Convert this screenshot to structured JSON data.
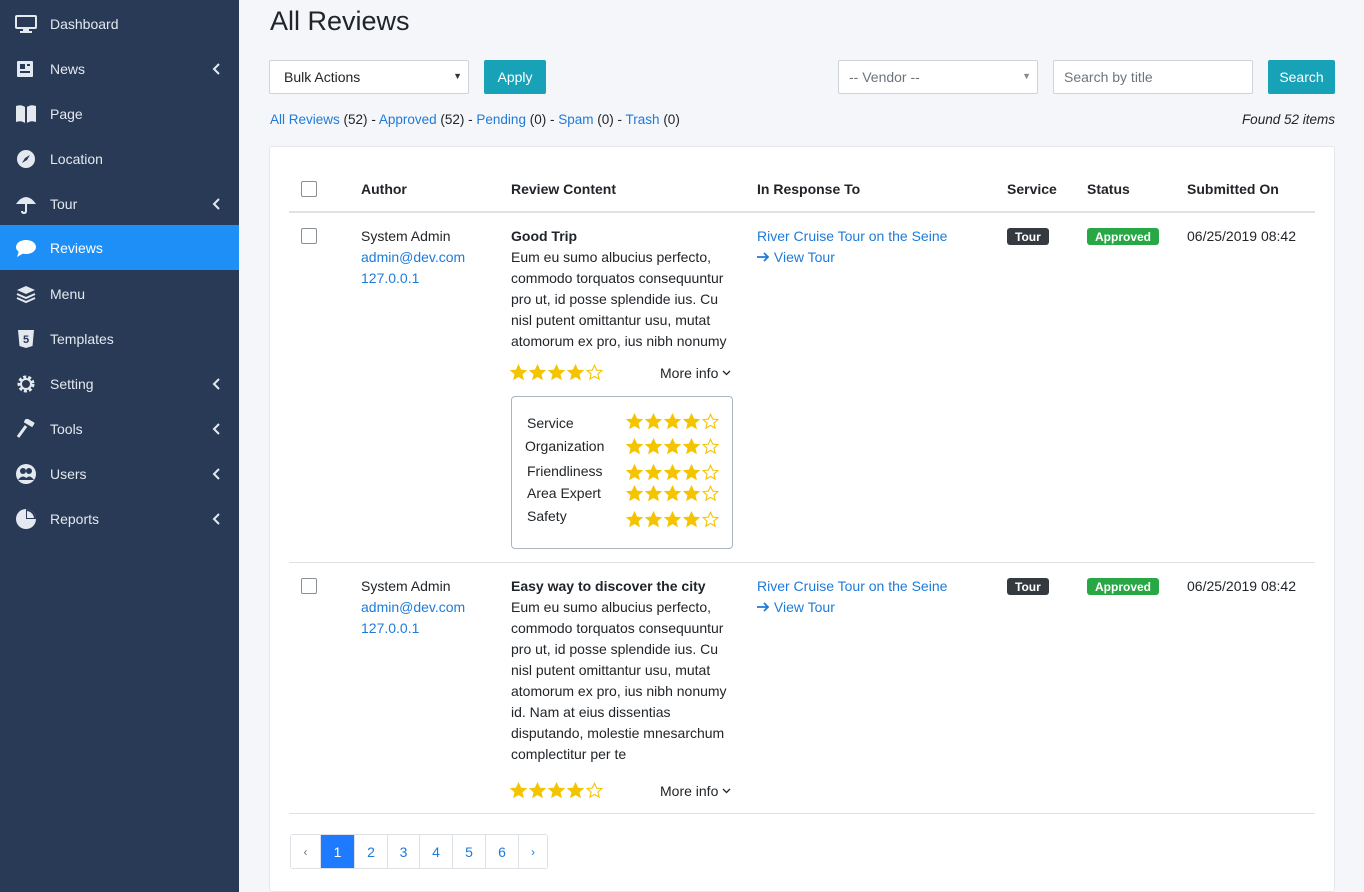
{
  "sidebar": {
    "items": [
      {
        "label": "Dashboard",
        "icon": "monitor-icon",
        "has_submenu": false,
        "active": false
      },
      {
        "label": "News",
        "icon": "newspaper-icon",
        "has_submenu": true,
        "active": false
      },
      {
        "label": "Page",
        "icon": "book-icon",
        "has_submenu": false,
        "active": false
      },
      {
        "label": "Location",
        "icon": "compass-icon",
        "has_submenu": false,
        "active": false
      },
      {
        "label": "Tour",
        "icon": "umbrella-icon",
        "has_submenu": true,
        "active": false
      },
      {
        "label": "Reviews",
        "icon": "comment-icon",
        "has_submenu": false,
        "active": true
      },
      {
        "label": "Menu",
        "icon": "layers-icon",
        "has_submenu": false,
        "active": false
      },
      {
        "label": "Templates",
        "icon": "html5-icon",
        "has_submenu": false,
        "active": false
      },
      {
        "label": "Setting",
        "icon": "gear-icon",
        "has_submenu": true,
        "active": false
      },
      {
        "label": "Tools",
        "icon": "hammer-icon",
        "has_submenu": true,
        "active": false
      },
      {
        "label": "Users",
        "icon": "users-icon",
        "has_submenu": true,
        "active": false
      },
      {
        "label": "Reports",
        "icon": "pie-chart-icon",
        "has_submenu": true,
        "active": false
      }
    ]
  },
  "page": {
    "title": "All Reviews",
    "bulk_actions": "Bulk Actions",
    "apply": "Apply",
    "vendor_placeholder": "-- Vendor --",
    "search_placeholder": "Search by title",
    "search": "Search",
    "found": "Found 52 items"
  },
  "filters": [
    {
      "label": "All Reviews",
      "count": "(52)"
    },
    {
      "label": "Approved",
      "count": "(52)"
    },
    {
      "label": "Pending",
      "count": "(0)"
    },
    {
      "label": "Spam",
      "count": "(0)"
    },
    {
      "label": "Trash",
      "count": "(0)"
    }
  ],
  "table": {
    "headers": {
      "author": "Author",
      "content": "Review Content",
      "response": "In Response To",
      "service": "Service",
      "status": "Status",
      "submitted": "Submitted On"
    },
    "rows": [
      {
        "author_name": "System Admin",
        "author_email": "admin@dev.com",
        "author_ip": "127.0.0.1",
        "title": "Good Trip",
        "body": "Eum eu sumo albucius perfecto, commodo torquatos consequuntur pro ut, id posse splendide ius. Cu nisl putent omittantur usu, mutat atomorum ex pro, ius nibh nonumy",
        "rating": 4,
        "more_info": "More info",
        "response_link": "River Cruise Tour on the Seine",
        "view_link": "View Tour",
        "service": "Tour",
        "status": "Approved",
        "submitted": "06/25/2019 08:42"
      },
      {
        "author_name": "System Admin",
        "author_email": "admin@dev.com",
        "author_ip": "127.0.0.1",
        "title": "Easy way to discover the city",
        "body": "Eum eu sumo albucius perfecto, commodo torquatos consequuntur pro ut, id posse splendide ius. Cu nisl putent omittantur usu, mutat atomorum ex pro, ius nibh nonumy id. Nam at eius dissentias disputando, molestie mnesarchum complectitur per te",
        "rating": 4,
        "more_info": "More info",
        "response_link": "River Cruise Tour on the Seine",
        "view_link": "View Tour",
        "service": "Tour",
        "status": "Approved",
        "submitted": "06/25/2019 08:42"
      }
    ],
    "detail_ratings": [
      {
        "label": "Service",
        "rating": 4
      },
      {
        "label": "Organization",
        "rating": 4
      },
      {
        "label": "Friendliness",
        "rating": 4
      },
      {
        "label": "Area Expert",
        "rating": 4
      },
      {
        "label": "Safety",
        "rating": 4
      }
    ]
  },
  "pagination": {
    "prev": "‹",
    "pages": [
      "1",
      "2",
      "3",
      "4",
      "5",
      "6"
    ],
    "current": "1",
    "next": "›"
  },
  "colors": {
    "sidebar_bg": "#283a55",
    "active_item": "#1e8ff7",
    "accent_teal": "#17a2b8",
    "link": "#1e7bd9",
    "star": "#f5c400",
    "approved": "#28a745",
    "tour_badge": "#343a40"
  }
}
